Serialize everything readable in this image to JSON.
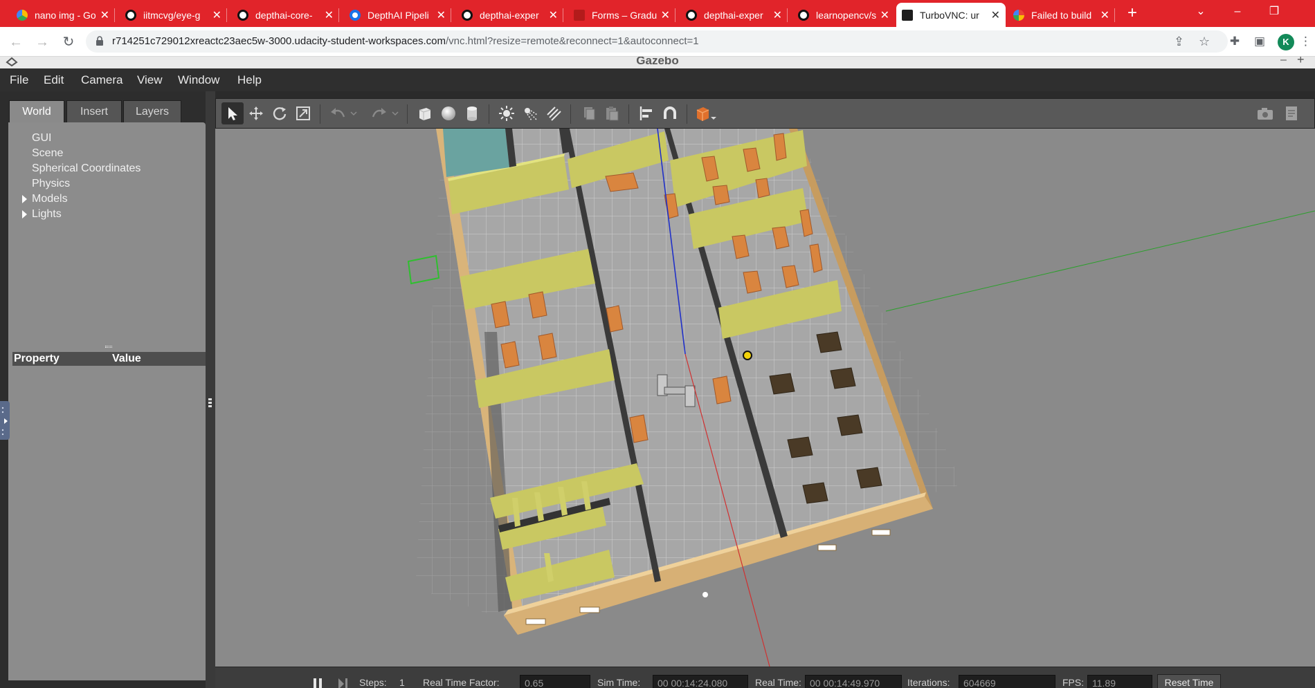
{
  "browser": {
    "tabs": [
      {
        "title": "nano img - Go",
        "icon": "google-drive-icon"
      },
      {
        "title": "iitmcvg/eye-g",
        "icon": "github-icon"
      },
      {
        "title": "depthai-core-",
        "icon": "github-icon"
      },
      {
        "title": "DepthAI Pipeli",
        "icon": "depthai-icon"
      },
      {
        "title": "depthai-exper",
        "icon": "github-icon"
      },
      {
        "title": "Forms – Gradu",
        "icon": "forms-icon"
      },
      {
        "title": "depthai-exper",
        "icon": "github-icon"
      },
      {
        "title": "learnopencv/s",
        "icon": "github-icon"
      },
      {
        "title": "TurboVNC: ur",
        "icon": "vnc-icon"
      },
      {
        "title": "Failed to build",
        "icon": "google-icon"
      }
    ],
    "active_tab_index": 8,
    "url_main": "r714251c729012xreactc23aec5w-3000.udacity-student-workspaces.com",
    "url_path": "/vnc.html?resize=remote&reconnect=1&autoconnect=1",
    "avatar_letter": "K",
    "accent_color": "#e1242a"
  },
  "gazebo": {
    "window_title": "Gazebo",
    "menu": [
      {
        "label": "File"
      },
      {
        "label": "Edit"
      },
      {
        "label": "Camera"
      },
      {
        "label": "View"
      },
      {
        "label": "Window"
      },
      {
        "label": "Help"
      }
    ],
    "left_tabs": [
      {
        "label": "World"
      },
      {
        "label": "Insert"
      },
      {
        "label": "Layers"
      }
    ],
    "tree_items": [
      {
        "label": "GUI",
        "expandable": false
      },
      {
        "label": "Scene",
        "expandable": false
      },
      {
        "label": "Spherical Coordinates",
        "expandable": false
      },
      {
        "label": "Physics",
        "expandable": false
      },
      {
        "label": "Models",
        "expandable": true
      },
      {
        "label": "Lights",
        "expandable": true
      }
    ],
    "property_header": {
      "property": "Property",
      "value": "Value"
    },
    "status": {
      "steps_label": "Steps:",
      "steps": "1",
      "rtf_label": "Real Time Factor:",
      "rtf": "0.65",
      "sim_time_label": "Sim Time:",
      "sim_time": "00 00:14:24.080",
      "real_time_label": "Real Time:",
      "real_time": "00 00:14:49.970",
      "iterations_label": "Iterations:",
      "iterations": "604669",
      "fps_label": "FPS:",
      "fps": "11.89",
      "reset_label": "Reset Time"
    }
  }
}
